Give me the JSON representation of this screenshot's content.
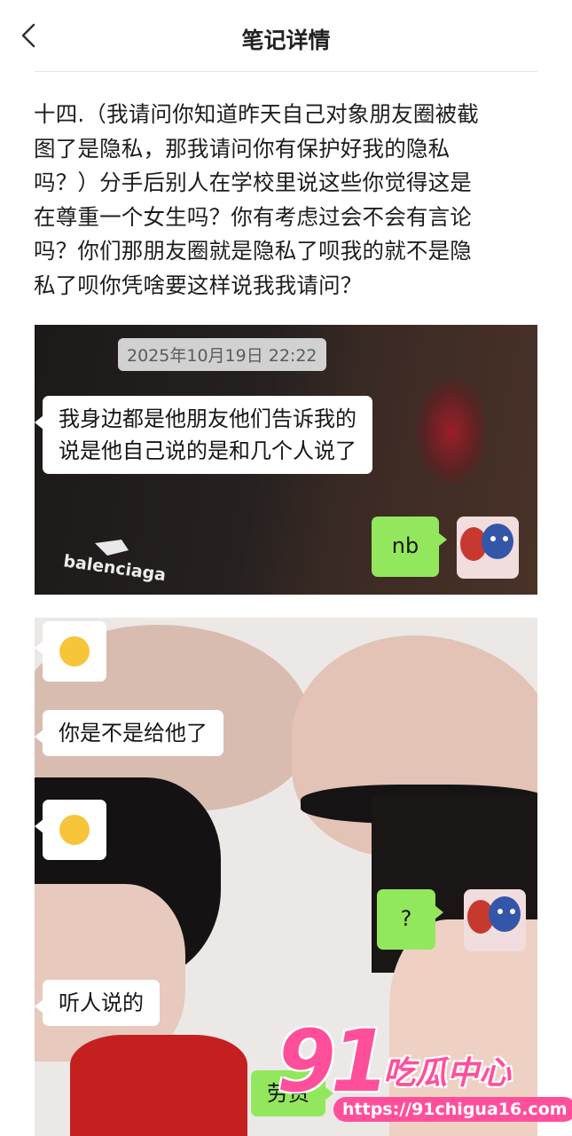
{
  "header": {
    "title": "笔记详情",
    "back_icon": "chevron-left-icon"
  },
  "post": {
    "lines": [
      "十四.（我请问你知道昨天自己对象朋友圈被截",
      "图了是隐私，那我请问你有保护好我的隐私",
      "吗？）分手后别人在学校里说这些你觉得这是",
      "在尊重一个女生吗？你有考虑过会不会有言论",
      "吗？你们那朋友圈就是隐私了呗我的就不是隐",
      "私了呗你凭啥要这样说我我请问？"
    ]
  },
  "screenshot1": {
    "timestamp": "2025年10月19日 22:22",
    "messages": [
      {
        "line1": "我身边都是他朋友他们告诉我的",
        "line2": "说是他自己说的是和几个人说了"
      },
      {
        "text": "nb"
      }
    ],
    "jacket_logo": "balenciaga"
  },
  "screenshot2": {
    "messages": [
      {
        "emoji": "crying-laughing-face-icon"
      },
      {
        "text": "你是不是给他了"
      },
      {
        "emoji": "shushing-face-icon"
      },
      {
        "text": "?"
      },
      {
        "text": "听人说的"
      },
      {
        "text": "劳资"
      }
    ]
  },
  "watermark": {
    "number": "91",
    "name": "吃瓜中心",
    "url": "https://91chigua16.com"
  },
  "colors": {
    "green_bubble": "#93e75d",
    "watermark_pink": "#ff4f9b"
  }
}
